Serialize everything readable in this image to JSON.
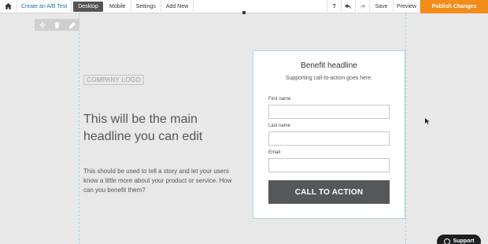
{
  "toolbar": {
    "home_icon": "home-icon",
    "ab_test_label": "Create an A/B Test",
    "desktop_label": "Desktop",
    "mobile_label": "Mobile",
    "settings_label": "Settings",
    "add_new_label": "Add New",
    "help_label": "?",
    "undo_icon": "undo-icon",
    "redo_icon": "redo-icon",
    "save_label": "Save",
    "preview_label": "Preview",
    "publish_label": "Publish Changes"
  },
  "section_tools": [
    "move-icon",
    "trash-icon",
    "pencil-icon"
  ],
  "content": {
    "logo_text": "COMPANY LOGO",
    "headline": "This will be the main headline you can edit",
    "body": "This should be used to tell a story and let your users know a little more about your product or service. How can you benefit them?"
  },
  "form": {
    "title": "Benefit headline",
    "subtitle": "Supporting call-to-action goes here.",
    "fields": [
      {
        "label": "First name",
        "value": ""
      },
      {
        "label": "Last name",
        "value": ""
      },
      {
        "label": "Email",
        "value": ""
      }
    ],
    "cta_label": "CALL TO ACTION"
  },
  "support": {
    "label": "Support",
    "icon": "chat-bubble-icon"
  },
  "colors": {
    "publish": "#f28c1a",
    "active_tab": "#545454",
    "cta": "#555859",
    "canvas": "#e8e8e9"
  }
}
